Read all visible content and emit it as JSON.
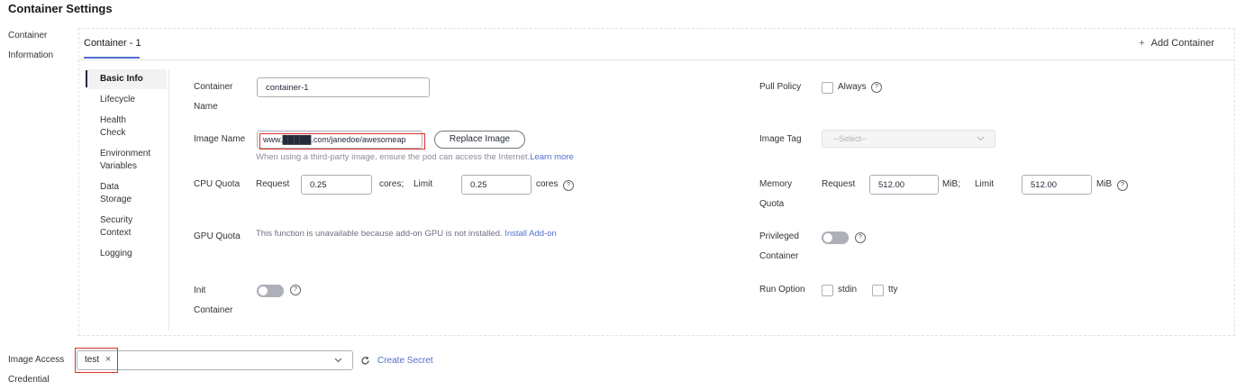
{
  "page": {
    "title": "Container Settings"
  },
  "section_labels": {
    "container_info_line1": "Container",
    "container_info_line2": "Information",
    "image_access_line1": "Image Access",
    "image_access_line2": "Credential"
  },
  "tabs": {
    "active": "Container - 1",
    "add": "Add Container"
  },
  "subnav": {
    "basic_info": "Basic Info",
    "lifecycle": "Lifecycle",
    "health_1": "Health",
    "health_2": "Check",
    "env_1": "Environment",
    "env_2": "Variables",
    "data_1": "Data",
    "data_2": "Storage",
    "security_1": "Security",
    "security_2": "Context",
    "logging": "Logging"
  },
  "form": {
    "container_name_label_1": "Container",
    "container_name_label_2": "Name",
    "container_name_value": "container-1",
    "image_name_label": "Image Name",
    "image_name_value": "www.█████.com/janedoe/awesomeap",
    "replace_image": "Replace Image",
    "image_hint": "When using a third-party image, ensure the pod can access the Internet.",
    "learn_more": "Learn more",
    "cpu_label": "CPU Quota",
    "cpu_request_label": "Request",
    "cpu_request_value": "0.25",
    "cpu_unit_1": "cores;",
    "cpu_limit_label": "Limit",
    "cpu_limit_value": "0.25",
    "cpu_unit_2": "cores",
    "gpu_label": "GPU Quota",
    "gpu_hint": "This function is unavailable because add-on GPU is not installed.",
    "install_addon": "Install Add-on",
    "init_label_1": "Init",
    "init_label_2": "Container",
    "pull_policy_label": "Pull Policy",
    "always": "Always",
    "image_tag_label": "Image Tag",
    "image_tag_placeholder": "--Select--",
    "memory_label_1": "Memory",
    "memory_label_2": "Quota",
    "mem_request_label": "Request",
    "mem_request_value": "512.00",
    "mem_unit_1": "MiB;",
    "mem_limit_label": "Limit",
    "mem_limit_value": "512.00",
    "mem_unit_2": "MiB",
    "privileged_1": "Privileged",
    "privileged_2": "Container",
    "run_option_label": "Run Option",
    "stdin": "stdin",
    "tty": "tty"
  },
  "credential": {
    "tag": "test",
    "create_secret": "Create Secret"
  },
  "colors": {
    "accent": "#526ecc",
    "highlight": "#e0312b"
  }
}
